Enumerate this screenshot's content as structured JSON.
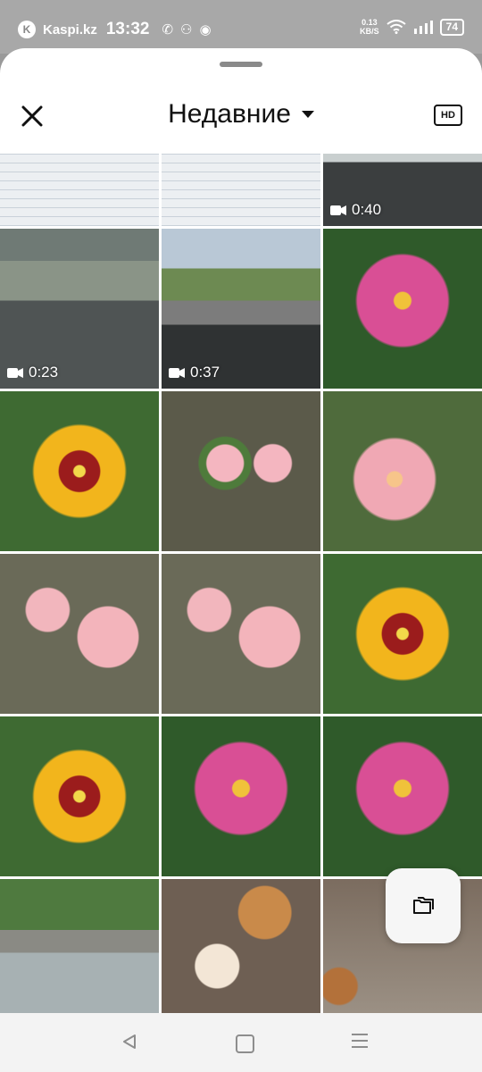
{
  "status_bar": {
    "app_label": "Kaspi.kz",
    "time": "13:32",
    "network_speed": "0.13",
    "network_unit": "KB/S",
    "battery": "74",
    "icons": [
      "whatsapp-icon",
      "people-icon",
      "chrome-icon",
      "wifi-icon",
      "signal-icon"
    ]
  },
  "header": {
    "title": "Недавние",
    "hd_label": "HD",
    "close_icon": "close-icon",
    "dropdown_icon": "caret-down-icon"
  },
  "videos": {
    "v1": "0:40",
    "v2": "0:23",
    "v3": "0:37"
  },
  "fab": {
    "icon": "folder-icon"
  },
  "nav": {
    "icons": [
      "back-icon",
      "home-icon",
      "recents-icon"
    ]
  }
}
